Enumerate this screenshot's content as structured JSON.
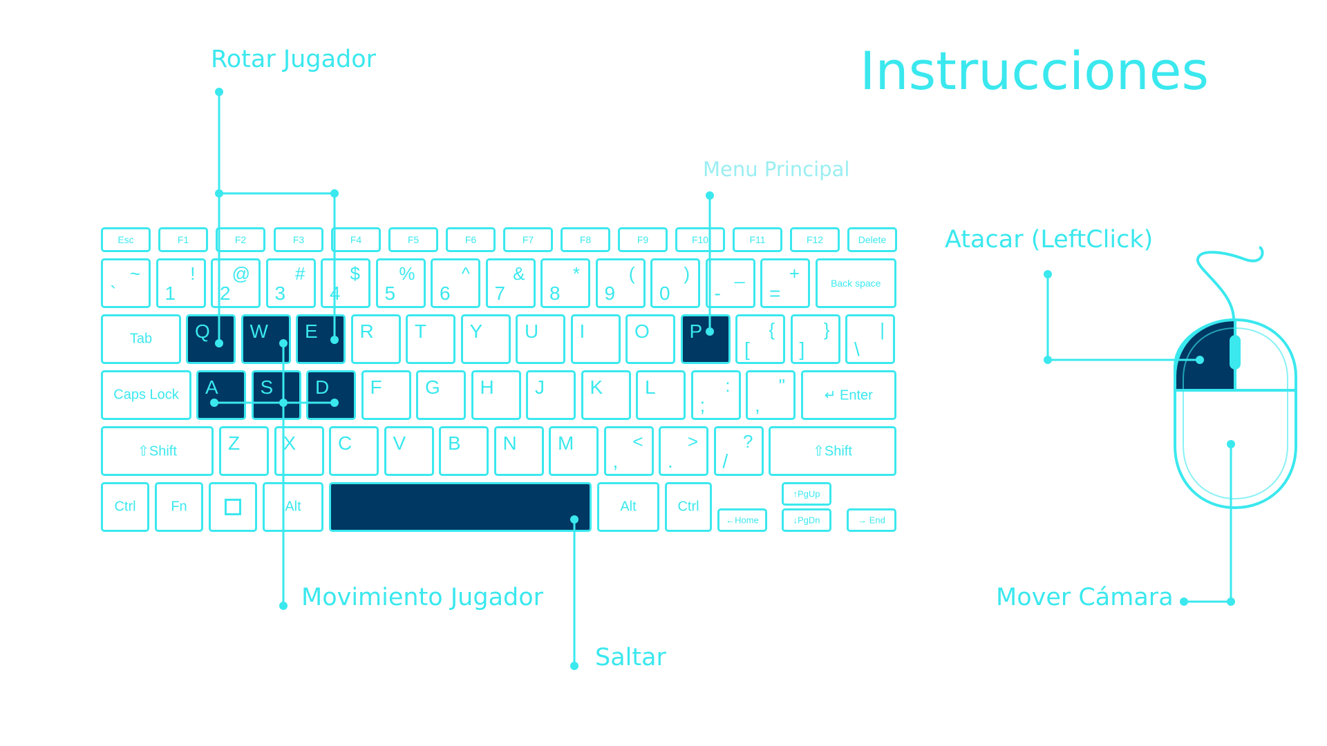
{
  "title": "Instrucciones",
  "labels": {
    "rotar": "Rotar Jugador",
    "menu": "Menu Principal",
    "atacar": "Atacar (LeftClick)",
    "movimiento": "Movimiento Jugador",
    "saltar": "Saltar",
    "camara": "Mover Cámara"
  },
  "colors": {
    "accent": "#3ae8ee",
    "highlight": "#003864",
    "background": "#ffffff"
  },
  "keyboard": {
    "fn_row": [
      "Esc",
      "F1",
      "F2",
      "F3",
      "F4",
      "F5",
      "F6",
      "F7",
      "F8",
      "F9",
      "F10",
      "F11",
      "F12",
      "Delete"
    ],
    "number_row": [
      {
        "top": "~",
        "bottom": "`"
      },
      {
        "top": "!",
        "bottom": "1"
      },
      {
        "top": "@",
        "bottom": "2"
      },
      {
        "top": "#",
        "bottom": "3"
      },
      {
        "top": "$",
        "bottom": "4"
      },
      {
        "top": "%",
        "bottom": "5"
      },
      {
        "top": "^",
        "bottom": "6"
      },
      {
        "top": "&",
        "bottom": "7"
      },
      {
        "top": "*",
        "bottom": "8"
      },
      {
        "top": "(",
        "bottom": "9"
      },
      {
        "top": ")",
        "bottom": "0"
      },
      {
        "top": "_",
        "bottom": "-"
      },
      {
        "top": "+",
        "bottom": "="
      }
    ],
    "backspace": "Back space",
    "tab": "Tab",
    "row_q": [
      "Q",
      "W",
      "E",
      "R",
      "T",
      "Y",
      "U",
      "I",
      "O",
      "P"
    ],
    "row_q_symbols": [
      {
        "top": "{",
        "bottom": "["
      },
      {
        "top": "}",
        "bottom": "]"
      },
      {
        "top": "|",
        "bottom": "\\"
      }
    ],
    "caps": "Caps Lock",
    "row_a": [
      "A",
      "S",
      "D",
      "F",
      "G",
      "H",
      "J",
      "K",
      "L"
    ],
    "row_a_symbols": [
      {
        "top": ":",
        "bottom": ";"
      },
      {
        "top": "\"",
        "bottom": ","
      }
    ],
    "enter": "Enter",
    "shift": "Shift",
    "row_z": [
      "Z",
      "X",
      "C",
      "V",
      "B",
      "N",
      "M"
    ],
    "row_z_symbols": [
      {
        "top": "<",
        "bottom": ","
      },
      {
        "top": ">",
        "bottom": "."
      },
      {
        "top": "?",
        "bottom": "/"
      }
    ],
    "ctrl": "Ctrl",
    "fn": "Fn",
    "alt": "Alt",
    "pgup": "PgUp",
    "pgdn": "PgDn",
    "home": "Home",
    "end": "End",
    "highlighted_keys": [
      "Q",
      "W",
      "E",
      "A",
      "S",
      "D",
      "P",
      "Space"
    ]
  },
  "icons": {
    "shift": "shift-arrow-icon",
    "enter": "enter-arrow-icon",
    "tab": "tab-arrows-icon",
    "windows": "windows-square-icon",
    "mouse": "mouse-icon"
  }
}
